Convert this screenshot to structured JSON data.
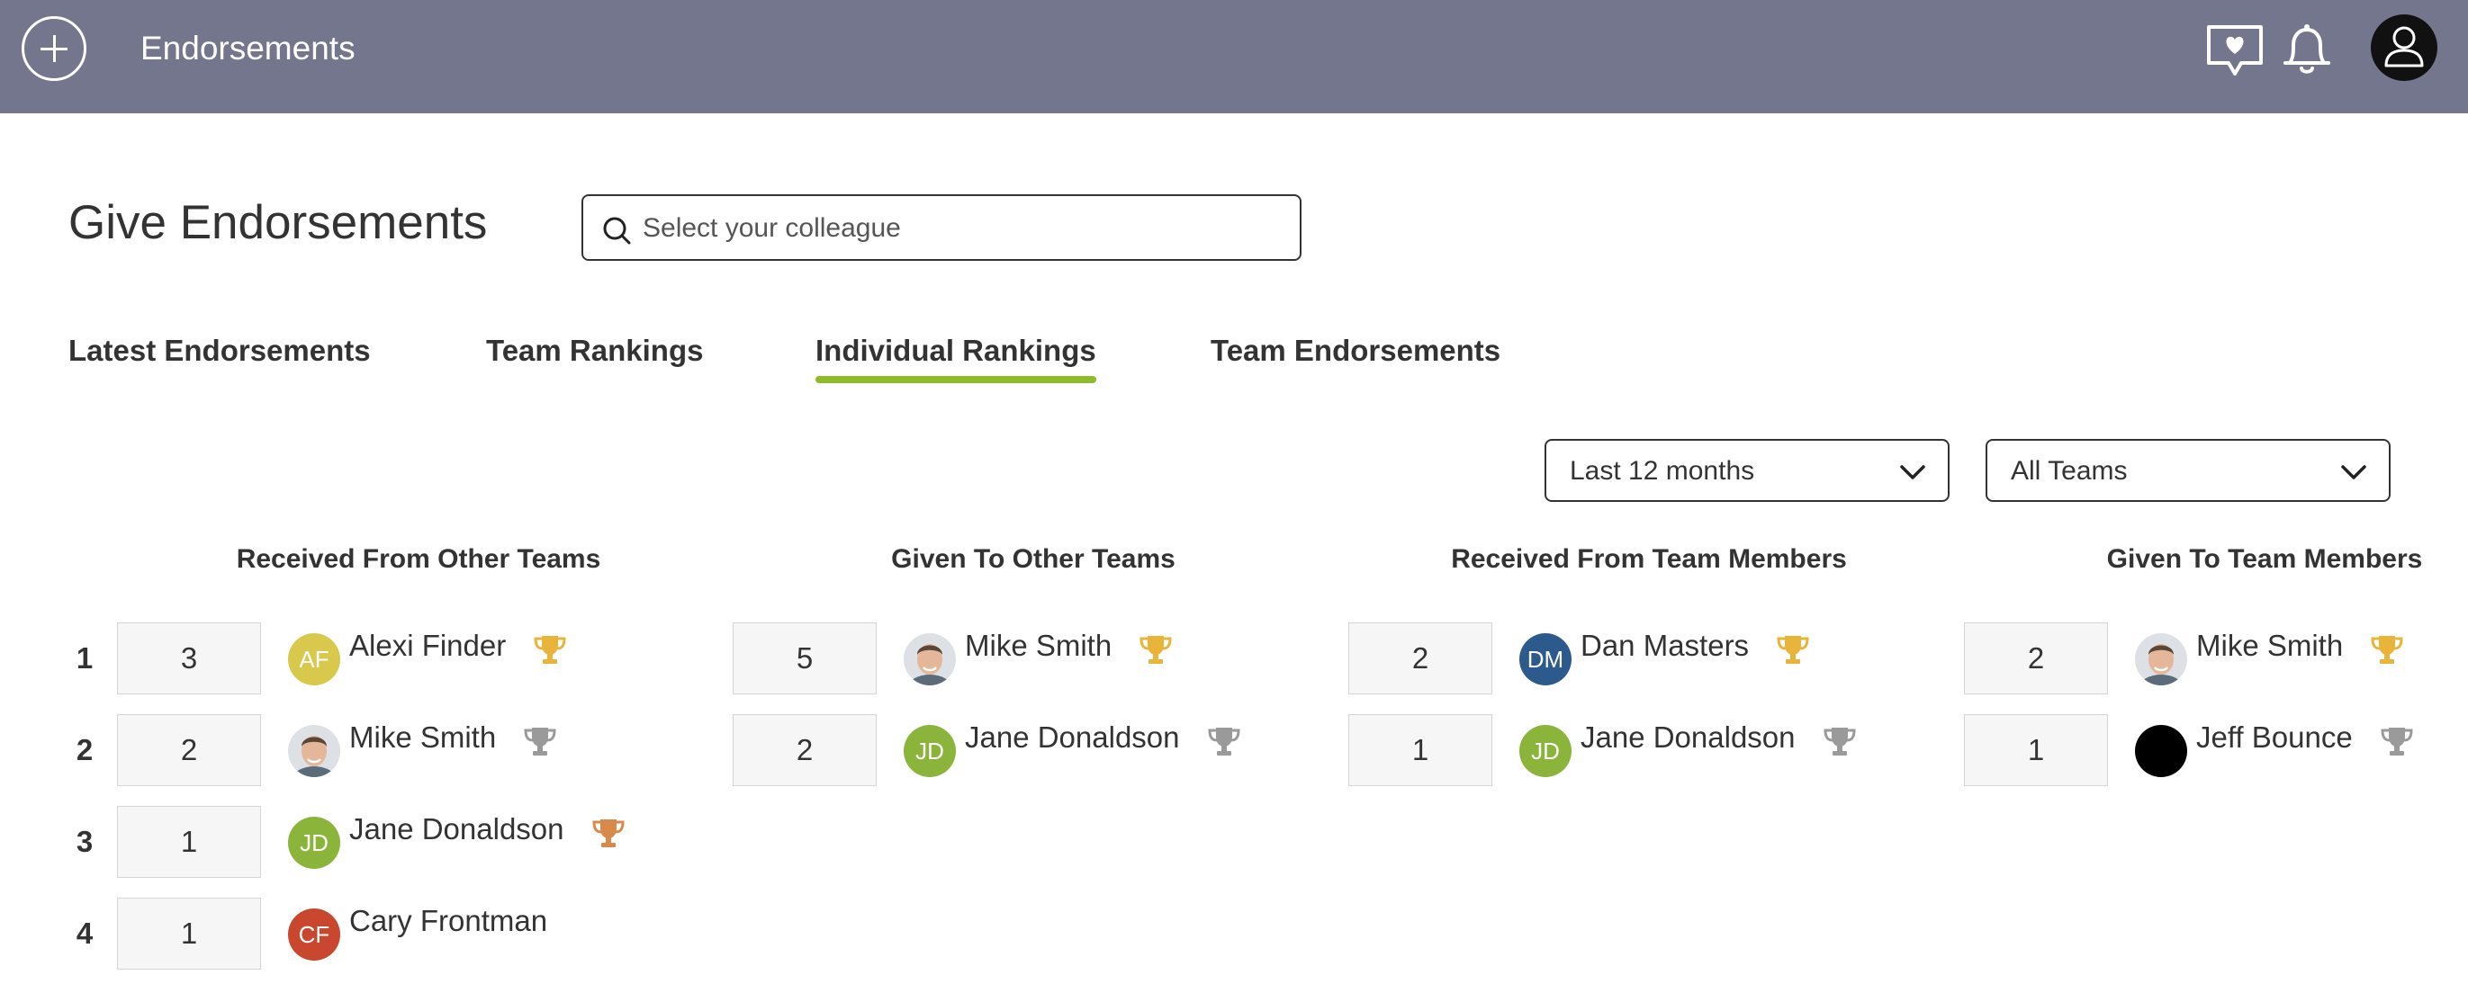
{
  "header": {
    "title": "Endorsements",
    "icons": [
      "add-icon",
      "endorsement-chat-icon",
      "bell-icon",
      "user-icon"
    ],
    "color": "#73768c"
  },
  "page": {
    "title": "Give Endorsements",
    "search_placeholder": "Select your colleague"
  },
  "tabs": [
    {
      "label": "Latest Endorsements",
      "active": false
    },
    {
      "label": "Team Rankings",
      "active": false
    },
    {
      "label": "Individual Rankings",
      "active": true
    },
    {
      "label": "Team Endorsements",
      "active": false
    }
  ],
  "filters": {
    "period": "Last 12 months",
    "team": "All Teams"
  },
  "ranks": [
    "1",
    "2",
    "3",
    "4"
  ],
  "columns": [
    {
      "title": "Received From Other Teams",
      "rows": [
        {
          "count": "3",
          "name": "Alexi Finder",
          "initials": "AF",
          "avatar_color": "#d8c84c",
          "trophy": "gold"
        },
        {
          "count": "2",
          "name": "Mike Smith",
          "initials": "",
          "avatar_color": "photo",
          "trophy": "silver"
        },
        {
          "count": "1",
          "name": "Jane Donaldson",
          "initials": "JD",
          "avatar_color": "#8ab53a",
          "trophy": "bronze"
        },
        {
          "count": "1",
          "name": "Cary Frontman",
          "initials": "CF",
          "avatar_color": "#c9472e",
          "trophy": "none"
        }
      ]
    },
    {
      "title": "Given To Other Teams",
      "rows": [
        {
          "count": "5",
          "name": "Mike Smith",
          "initials": "",
          "avatar_color": "photo",
          "trophy": "gold"
        },
        {
          "count": "2",
          "name": "Jane Donaldson",
          "initials": "JD",
          "avatar_color": "#8ab53a",
          "trophy": "silver"
        }
      ]
    },
    {
      "title": "Received From Team Members",
      "rows": [
        {
          "count": "2",
          "name": "Dan Masters",
          "initials": "DM",
          "avatar_color": "#2d5a8c",
          "trophy": "gold"
        },
        {
          "count": "1",
          "name": "Jane Donaldson",
          "initials": "JD",
          "avatar_color": "#8ab53a",
          "trophy": "silver"
        }
      ]
    },
    {
      "title": "Given To Team Members",
      "rows": [
        {
          "count": "2",
          "name": "Mike Smith",
          "initials": "",
          "avatar_color": "photo",
          "trophy": "gold"
        },
        {
          "count": "1",
          "name": "Jeff Bounce",
          "initials": "",
          "avatar_color": "#000000",
          "trophy": "silver"
        }
      ]
    }
  ],
  "colors": {
    "accent": "#8dbb2c",
    "trophy_gold": "#e8b43a",
    "trophy_silver": "#9a9a9a",
    "trophy_bronze": "#d98a4a"
  }
}
